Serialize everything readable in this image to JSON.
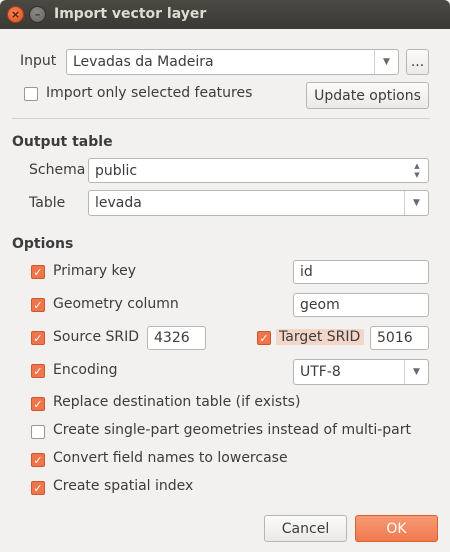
{
  "window": {
    "title": "Import vector layer",
    "close_glyph": "×",
    "minimize_glyph": "–"
  },
  "input": {
    "label": "Input",
    "value": "Levadas da Madeira",
    "browse_label": "...",
    "only_selected_label": "Import only selected features",
    "only_selected_checked": false,
    "update_options_label": "Update options"
  },
  "output_table": {
    "section_label": "Output table",
    "schema_label": "Schema",
    "schema_value": "public",
    "table_label": "Table",
    "table_value": "levada"
  },
  "options": {
    "section_label": "Options",
    "primary_key_label": "Primary key",
    "primary_key_value": "id",
    "geometry_column_label": "Geometry column",
    "geometry_column_value": "geom",
    "source_srid_label": "Source SRID",
    "source_srid_value": "4326",
    "target_srid_label": "Target SRID",
    "target_srid_value": "5016",
    "encoding_label": "Encoding",
    "encoding_value": "UTF-8",
    "replace_label": "Replace destination table (if exists)",
    "single_part_label": "Create single-part geometries instead of multi-part",
    "lowercase_label": "Convert field names to lowercase",
    "spatial_index_label": "Create spatial index"
  },
  "checks": {
    "primary_key": true,
    "geometry_column": true,
    "source_srid": true,
    "target_srid": true,
    "encoding": true,
    "replace": true,
    "single_part": false,
    "lowercase": true,
    "spatial_index": true
  },
  "buttons": {
    "cancel_label": "Cancel",
    "ok_label": "OK"
  },
  "colors": {
    "accent": "#f0754a",
    "titlebar": "#3f3e3a",
    "background": "#f2f1f0"
  },
  "icons": {
    "check": "✓",
    "combo_arrow": "▼",
    "spin_up": "▲",
    "spin_down": "▼"
  }
}
